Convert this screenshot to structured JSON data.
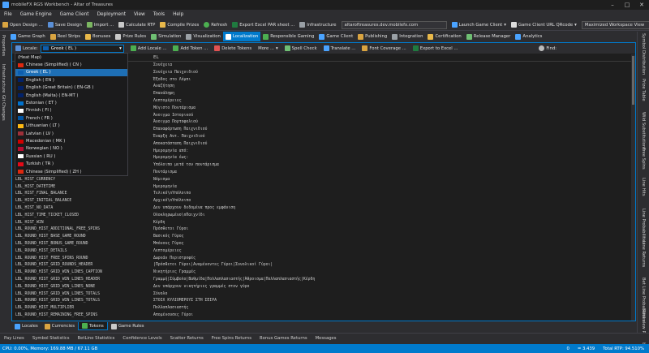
{
  "window": {
    "title": "mobileFX RGS Workbench - Altar of Treasures"
  },
  "menu": [
    "File",
    "Game Engine",
    "Game Client",
    "Deployment",
    "View",
    "Tools",
    "Help"
  ],
  "toolbar1": {
    "open": "Open Design ...",
    "save": "Save Design",
    "import": "Import ...",
    "calc_rtp": "Calculate RTP",
    "compile": "Compile Prizes",
    "refresh": "Refresh",
    "export_par": "Export Excel PAR sheet ...",
    "infra": "Infrastructure",
    "infra_value": "altaroftreasures.dev.mobilefx.com",
    "launch": "Launch Game Client",
    "qr": "Game Client URL QRcode",
    "workspace": "Maximized Workspace View"
  },
  "tabs": [
    "Game Graph",
    "Reel Strips",
    "Bonuses",
    "Prize Rules",
    "Simulation",
    "Visualization",
    "Localization",
    "Responsible Gaming",
    "Game Client",
    "Publishing",
    "Integration",
    "Certification",
    "Release Manager",
    "Analytics"
  ],
  "left_side": [
    "Properties",
    "Infrastructure",
    "Git Changes"
  ],
  "right_side": [
    "Symbol Distribution",
    "Prize Table",
    "Wild Substitutions",
    "Free Spins",
    "Line Hits",
    "Line Probabilities",
    "Line Returns",
    "Bet Line Probabilities",
    "Reel view Probabilities"
  ],
  "panel_toolbar": {
    "locale_label": "Locale:",
    "locale_value": "Greek ( EL )",
    "add_locale": "Add Locale ...",
    "add_token": "Add Token ...",
    "delete_tokens": "Delete Tokens",
    "more": "More ...",
    "spell": "Spell Check",
    "translate": "Translate ...",
    "font_coverage": "Font Coverage ...",
    "export_excel": "Export to Excel ...",
    "find": "Find:"
  },
  "grid": {
    "col_el": "EL",
    "rows": [
      {
        "key": "",
        "value": "Συνέχεια"
      },
      {
        "key": "",
        "value": "Συνέχεια Παιχνιδιού"
      },
      {
        "key": "",
        "value": "Έξοδος στο Λόμπι"
      },
      {
        "key": "",
        "value": "Αναζήτηση"
      },
      {
        "key": "",
        "value": "Επανάληψη"
      },
      {
        "key": "",
        "value": "Λεπτομέρειες"
      },
      {
        "key": "",
        "value": "Μέγιστο Ποντάρισμα"
      },
      {
        "key": "",
        "value": "Άνοιγμα Ιστορικού"
      },
      {
        "key": "",
        "value": "Άνοιγμα Πορτοφολιού"
      },
      {
        "key": "",
        "value": "Επαναφόρτωση Παιχνιδιού"
      },
      {
        "key": "",
        "value": "Έναρξη Αυτ. Παιχνιδιού"
      },
      {
        "key": "",
        "value": "Αποκατάσταση Παιχνιδιού"
      },
      {
        "key": "",
        "value": "Ημερομηνία από:"
      },
      {
        "key": "",
        "value": "Ημερομηνία έως:"
      },
      {
        "key": "",
        "value": "Υπόλοιπο μετά τον ποντάρισμα"
      },
      {
        "key": "",
        "value": "Ποντάρισμα"
      },
      {
        "key": "LBL_HIST_CURRENCY",
        "value": "Νόμισμα"
      },
      {
        "key": "LBL_HIST_DATETIME",
        "value": "Ημερομηνία"
      },
      {
        "key": "LBL_HIST_FINAL_BALANCE",
        "value": "Τελικό\\nΥπόλοιπο"
      },
      {
        "key": "LBL_HIST_INITIAL_BALANCE",
        "value": "Αρχικό\\nΥπόλοιπο"
      },
      {
        "key": "LBL_HIST_NO_DATA",
        "value": "Δεν υπάρχουν δεδομένα προς εμφάνιση"
      },
      {
        "key": "LBL_HIST_TIME_TICKET_CLOSED",
        "value": "Ολοκληρωμένο\\nΠαιχνίδι"
      },
      {
        "key": "LBL_HIST_WIN",
        "value": "Κέρδη"
      },
      {
        "key": "LBL_ROUND_HIST_ADDITIONAL_FREE_SPINS",
        "value": "Πρόσθετοι Γύροι"
      },
      {
        "key": "LBL_ROUND_HIST_BASE_GAME_ROUND",
        "value": "Βασικός Γύρος"
      },
      {
        "key": "LBL_ROUND_HIST_BONUS_GAME_ROUND",
        "value": "Μπόνους Γύρος"
      },
      {
        "key": "LBL_ROUND_HIST_DETAILS",
        "value": "Λεπτομέρειες"
      },
      {
        "key": "LBL_ROUND_HIST_FREE_SPINS_ROUND",
        "value": "Δωρεάν Περιστροφές"
      },
      {
        "key": "LBL_ROUND_HIST_GRID_ROUNDS_HEADER",
        "value": "|Πρόσθετοι Γύροι|Αναμένοντες Γύροι|Συνολικοί Γύροι|"
      },
      {
        "key": "LBL_ROUND_HIST_GRID_WIN_LINES_CAPTION",
        "value": "Νικητήριες Γραμμές"
      },
      {
        "key": "LBL_ROUND_HIST_GRID_WIN_LINES_HEADER",
        "value": "Γραμμή|Σύμβολο|Βαθμίδα|Πολλαπλασιαστής|Άθροισμα|Πολλαπλασιαστής|Κέρδη"
      },
      {
        "key": "LBL_ROUND_HIST_GRID_WIN_LINES_NONE",
        "value": "Δεν υπάρχουν νικητήριες γραμμές στον γύρο"
      },
      {
        "key": "LBL_ROUND_HIST_GRID_WIN_LINES_TOTALS",
        "value": "Σύνολο"
      },
      {
        "key": "LBL_ROUND_HIST_GRID_WIN_LINES_TOTALS",
        "value": "ΣΤΟΙΧ ΚΥΛΙΟΜΕΡΟΥΣ ΣΤΗ ΣΕΙΡΑ"
      },
      {
        "key": "LBL_ROUND_HIST_MULTIPLIER",
        "value": "Πολλαπλασιαστής"
      },
      {
        "key": "LBL_ROUND_HIST_REMAINING_FREE_SPINS",
        "value": "Απομένουσες Γύροι"
      }
    ]
  },
  "locales": [
    {
      "label": "(Heat Map)",
      "flag": ""
    },
    {
      "label": "Chinese (Simplified) ( CN )",
      "flag": "#de2910"
    },
    {
      "label": "Greek ( EL )",
      "flag": "#0d5eaf"
    },
    {
      "label": "English ( EN )",
      "flag": "#012169"
    },
    {
      "label": "English (Great Britain) ( EN-GB )",
      "flag": "#012169"
    },
    {
      "label": "English (Malta) ( EN-MT )",
      "flag": "#012169"
    },
    {
      "label": "Estonian ( ET )",
      "flag": "#0072ce"
    },
    {
      "label": "Finnish ( FI )",
      "flag": "#ffffff"
    },
    {
      "label": "French ( FR )",
      "flag": "#0055a4"
    },
    {
      "label": "Lithuanian ( LT )",
      "flag": "#fdb913"
    },
    {
      "label": "Latvian ( LV )",
      "flag": "#9e3039"
    },
    {
      "label": "Macedonian ( MK )",
      "flag": "#d20000"
    },
    {
      "label": "Norwegian ( NO )",
      "flag": "#ba0c2f"
    },
    {
      "label": "Russian ( RU )",
      "flag": "#ffffff"
    },
    {
      "label": "Turkish ( TR )",
      "flag": "#e30a17"
    },
    {
      "label": "Chinese (Simplified) ( ZH )",
      "flag": "#de2910"
    }
  ],
  "selected_locale_index": 2,
  "subtabs": [
    "Locales",
    "Currencies",
    "Tokens",
    "Game Rules"
  ],
  "bottom_tabs": [
    "Pay Lines",
    "Symbol Statistics",
    "BetLine Statistics",
    "Confidence Levels",
    "Scatter Returns",
    "Free Spins Returns",
    "Bonus Games Returns",
    "Messages"
  ],
  "status": {
    "cpu": "CPU: 0.00%, Memory: 169.88 MB / 67.11 GB",
    "left_num": "0",
    "mid_num": "= 3.439",
    "rtp": "Total RTP: 94.510%"
  },
  "colors": {
    "accent": "#007acc",
    "bg": "#1e1e1e"
  }
}
